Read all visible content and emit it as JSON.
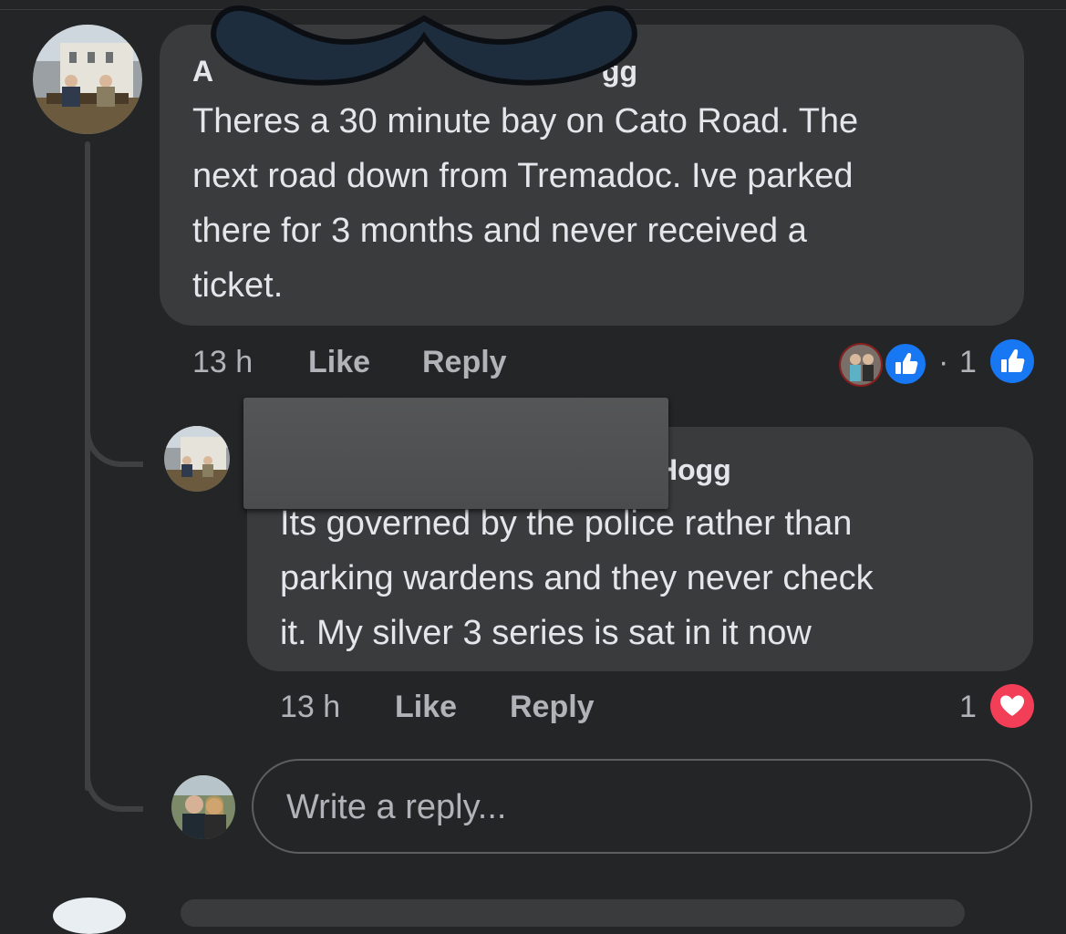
{
  "comment": {
    "author_visible_start": "A",
    "author_visible_end": "gg",
    "text_lines": [
      "Theres a 30 minute bay on Cato Road. The",
      "next road down from Tremadoc. Ive parked",
      "there for 3 months and never received a",
      "ticket."
    ],
    "time": "13 h",
    "like_label": "Like",
    "reply_label": "Reply",
    "reaction_sep": "·",
    "reaction_count": "1"
  },
  "reply": {
    "author_visible_end": "Hogg",
    "text_lines": [
      "Its governed by the police rather than",
      "parking wardens and they never check",
      "it. My silver 3 series is sat in it now"
    ],
    "time": "13 h",
    "like_label": "Like",
    "reply_label": "Reply",
    "reaction_count": "1"
  },
  "composer": {
    "placeholder": "Write a reply..."
  },
  "colors": {
    "background": "#242526",
    "bubble": "#3a3b3c",
    "like_blue": "#1877f2",
    "love_red": "#f33e58"
  }
}
